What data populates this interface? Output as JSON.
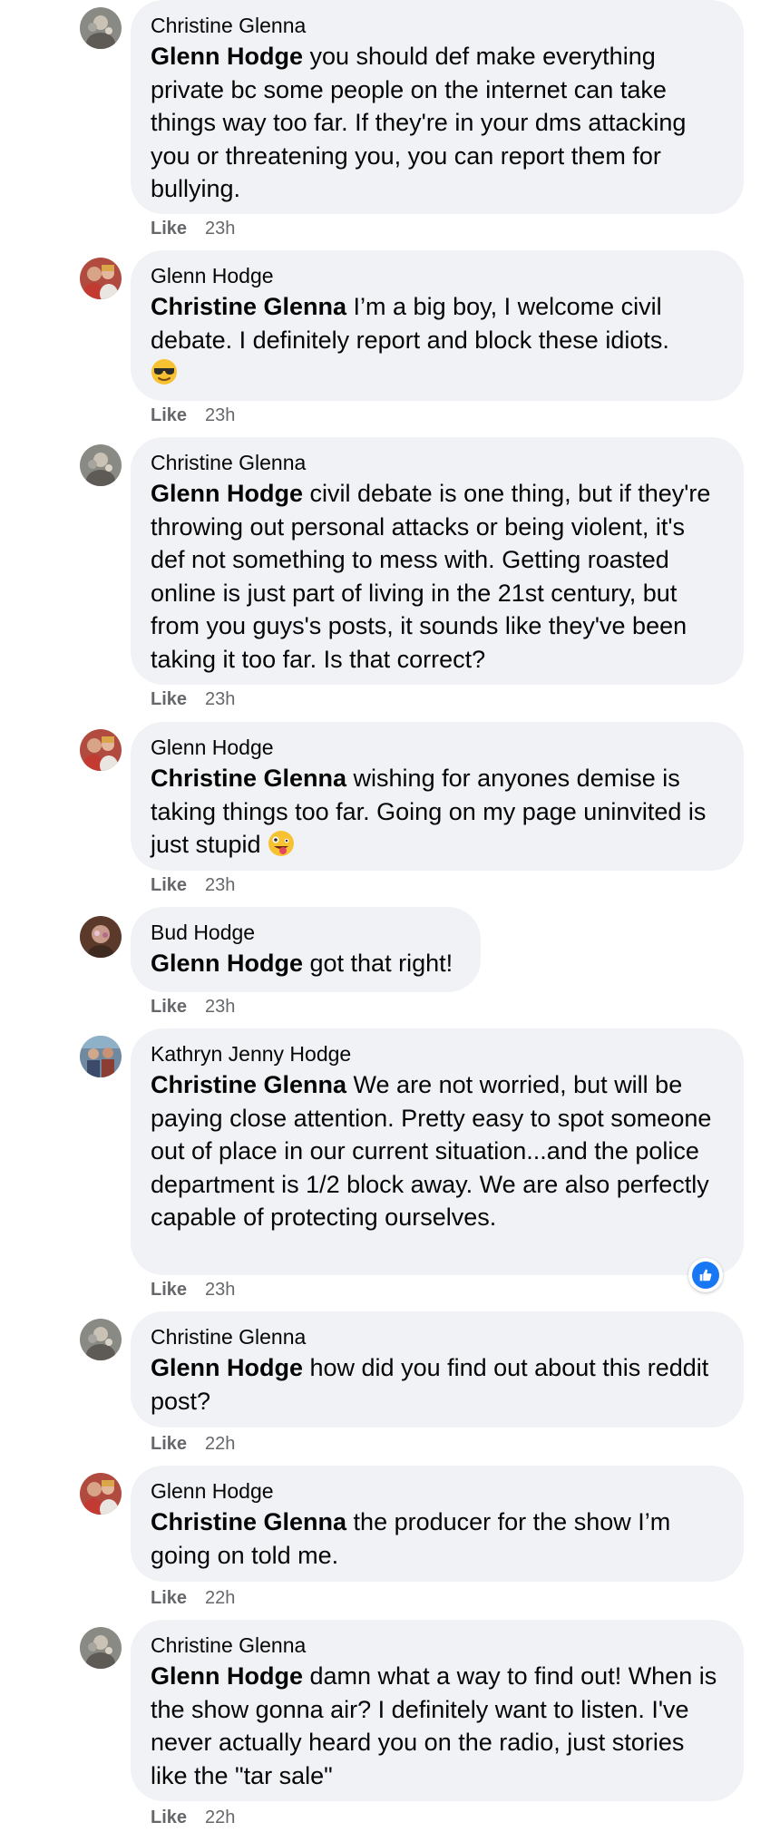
{
  "comments": [
    {
      "author": "Christine Glenna",
      "mention": "Glenn Hodge",
      "text": " you should def make everything private bc some people on the internet can take things way too far. If they're in your dms attacking you or threatening you, you can report them for bullying.",
      "like": "Like",
      "time": "23h"
    },
    {
      "author": "Glenn Hodge",
      "mention": "Christine Glenna",
      "text": " I’m a big boy, I welcome civil debate. I definitely report and block these idiots.",
      "emoji": "smiling-face-with-sunglasses",
      "like": "Like",
      "time": "23h"
    },
    {
      "author": "Christine Glenna",
      "mention": "Glenn Hodge",
      "text": " civil debate is one thing, but if they're throwing out personal attacks or being violent, it's def not something to mess with. Getting roasted online is just part of living in the 21st century, but from you guys's posts, it sounds like they've been taking it too far. Is that correct?",
      "like": "Like",
      "time": "23h"
    },
    {
      "author": "Glenn Hodge",
      "mention": "Christine Glenna",
      "text": " wishing for anyones demise is taking things too far. Going on my page uninvited is just stupid ",
      "emoji": "zany-face",
      "like": "Like",
      "time": "23h"
    },
    {
      "author": "Bud Hodge",
      "mention": "Glenn Hodge",
      "text": " got that right!",
      "like": "Like",
      "time": "23h"
    },
    {
      "author": "Kathryn Jenny Hodge",
      "mention": "Christine Glenna",
      "text": " We are not worried, but will be paying close attention. Pretty easy to spot someone out of place in our current situation...and the police department is 1/2 block away. We are also perfectly capable of protecting ourselves.",
      "like": "Like",
      "time": "23h",
      "reaction": "thumbs-up-icon"
    },
    {
      "author": "Christine Glenna",
      "mention": "Glenn Hodge",
      "text": " how did you find out about this reddit post?",
      "like": "Like",
      "time": "22h"
    },
    {
      "author": "Glenn Hodge",
      "mention": "Christine Glenna",
      "text": " the producer for the show I’m going on told me.",
      "like": "Like",
      "time": "22h"
    },
    {
      "author": "Christine Glenna",
      "mention": "Glenn Hodge",
      "text": " damn what a way to find out! When is the show gonna air? I definitely want to listen. I've never actually heard you on the radio, just stories like the \"tar sale\"",
      "like": "Like",
      "time": "22h"
    }
  ],
  "colors": {
    "bubble": "#f0f2f5",
    "meta_text": "#65676b",
    "reaction_blue": "#1877f2"
  }
}
